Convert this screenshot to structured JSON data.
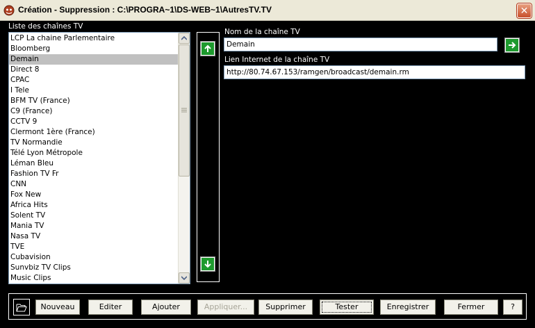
{
  "window": {
    "title": "Création - Suppression : C:\\PROGRA~1\\DS-WEB~1\\AutresTV.TV",
    "close_label": "✕"
  },
  "list": {
    "label": "Liste des chaînes TV",
    "selected_index": 2,
    "items": [
      "LCP La chaine Parlementaire",
      "Bloomberg",
      "Demain",
      "Direct 8",
      "CPAC",
      "I Tele",
      "BFM TV (France)",
      "C9 (France)",
      "CCTV 9",
      "Clermont 1ère (France)",
      "TV Normandie",
      "Télé Lyon Métropole",
      "Léman Bleu",
      "Fashion TV Fr",
      "CNN",
      "Fox New",
      "Africa Hits",
      "Solent TV",
      "Mania TV",
      "Nasa TV",
      "TVE",
      "Cubavision",
      "Sunvbiz TV Clips",
      "Music Clips"
    ]
  },
  "form": {
    "name_label": "Nom de la chaîne TV",
    "name_value": "Demain",
    "url_label": "Lien Internet de la chaîne TV",
    "url_value": "http://80.74.67.153/ramgen/broadcast/demain.rm"
  },
  "buttons": {
    "nouveau": "Nouveau",
    "editer": "Editer",
    "ajouter": "Ajouter",
    "appliquer": "Appliquer...",
    "supprimer": "Supprimer",
    "tester": "Tester",
    "enregistrer": "Enregistrer",
    "fermer": "Fermer",
    "help": "?"
  },
  "colors": {
    "accent_green": "#1e9a2e",
    "selection": "#c0c0c0",
    "background": "#000000"
  }
}
